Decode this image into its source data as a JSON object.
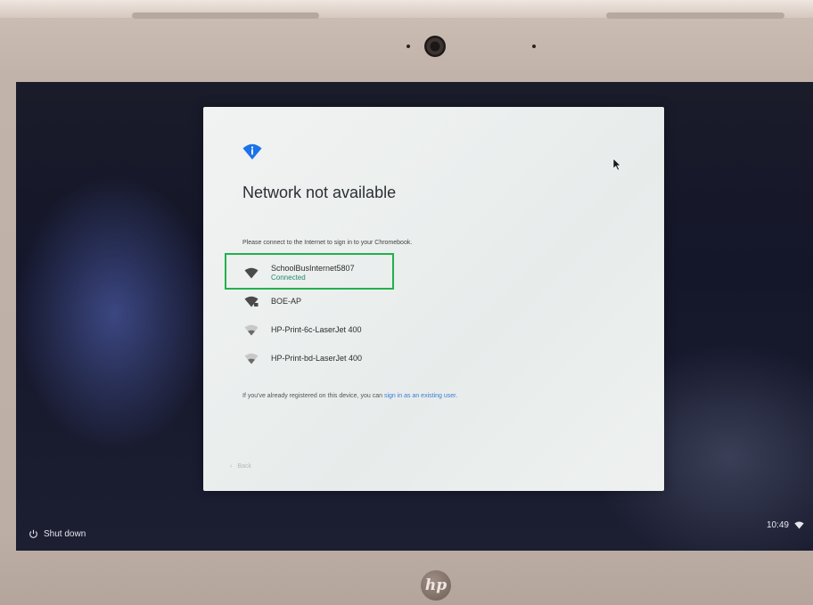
{
  "dialog": {
    "title": "Network not available",
    "subtitle": "Please connect to the Internet to sign in to your Chromebook.",
    "networks": [
      {
        "name": "SchoolBusInternet5807",
        "status": "Connected",
        "icon": "wifi-icon"
      },
      {
        "name": "BOE-AP",
        "status": "",
        "icon": "wifi-lock-icon"
      },
      {
        "name": "HP-Print-6c-LaserJet 400",
        "status": "",
        "icon": "wifi-icon"
      },
      {
        "name": "HP-Print-bd-LaserJet 400",
        "status": "",
        "icon": "wifi-icon"
      }
    ],
    "register_text": "If you've already registered on this device, you can ",
    "register_link": "sign in as an existing user",
    "register_end": ".",
    "back_label": "Back"
  },
  "shelf": {
    "shutdown_label": "Shut down",
    "clock": "10:49"
  },
  "brand": {
    "logo_text": "hp"
  },
  "colors": {
    "accent": "#1a73e8",
    "connected": "#1f8a6f",
    "highlight": "#22b14c"
  }
}
